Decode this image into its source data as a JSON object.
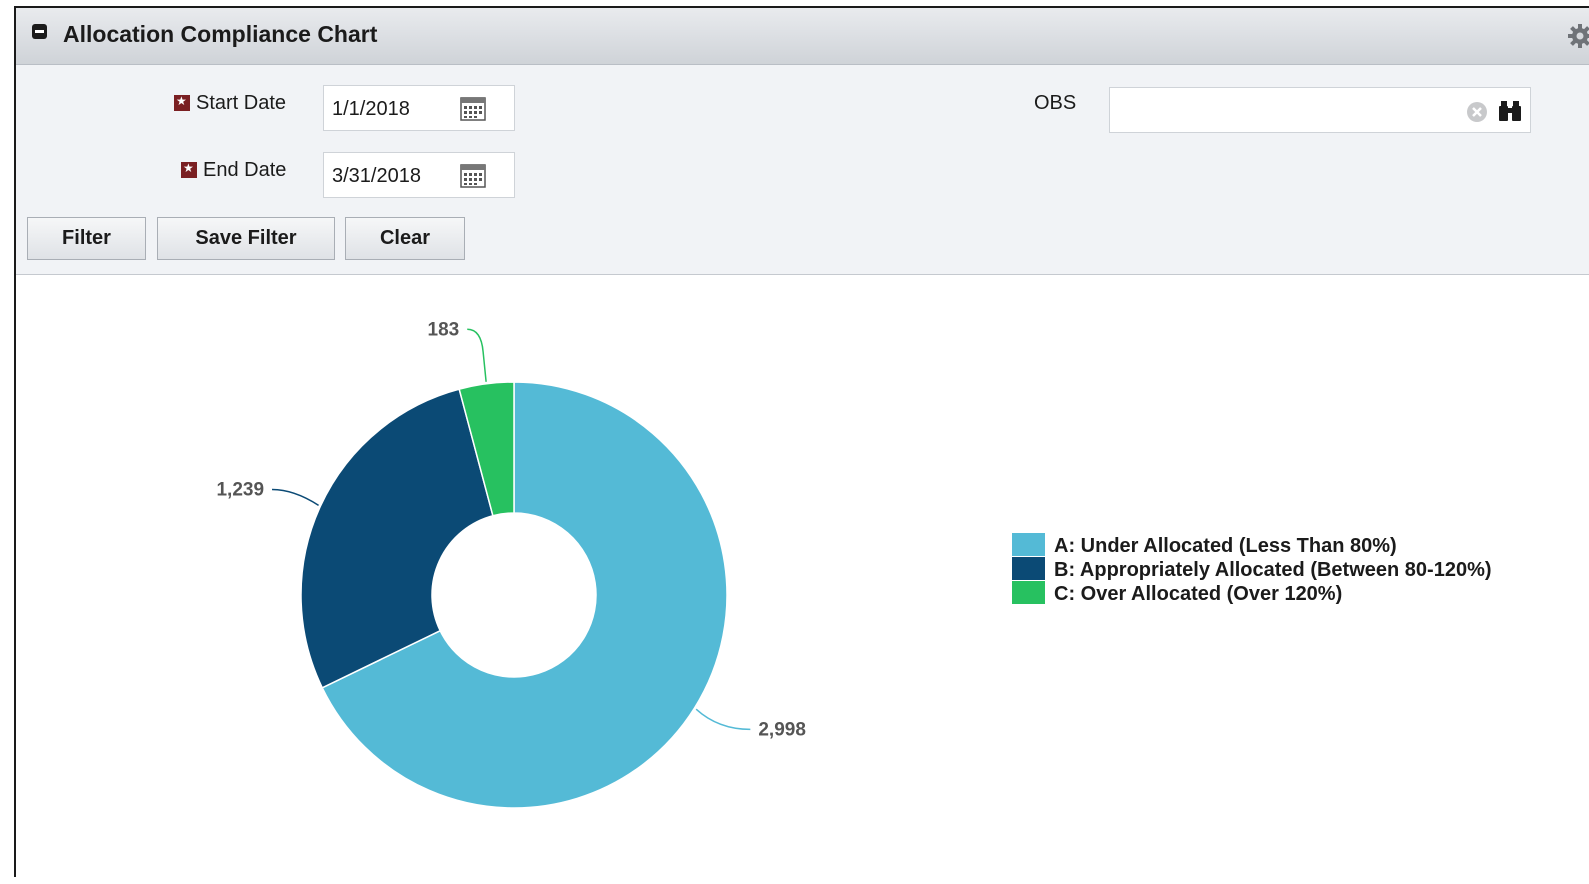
{
  "window": {
    "title": "Allocation Compliance Chart"
  },
  "filters": {
    "start_date_label": "Start Date",
    "start_date_value": "1/1/2018",
    "end_date_label": "End Date",
    "end_date_value": "3/31/2018",
    "obs_label": "OBS",
    "obs_value": ""
  },
  "buttons": {
    "filter": "Filter",
    "save_filter": "Save Filter",
    "clear": "Clear"
  },
  "icons": {
    "collapse": "collapse-icon",
    "gear": "gear-icon",
    "calendar": "calendar-icon",
    "clear": "clear-icon",
    "binoculars": "binoculars-icon",
    "required": "required-star-icon"
  },
  "chart_data": {
    "type": "pie",
    "style": "donut",
    "categories": [
      "A: Under Allocated (Less Than 80%)",
      "B: Appropriately Allocated (Between 80-120%)",
      "C: Over Allocated (Over 120%)"
    ],
    "values": [
      2998,
      1239,
      183
    ],
    "value_labels": [
      "2,998",
      "1,239",
      "183"
    ],
    "colors": [
      "#54bad6",
      "#0b4a75",
      "#27c160"
    ],
    "legend_position": "right"
  }
}
